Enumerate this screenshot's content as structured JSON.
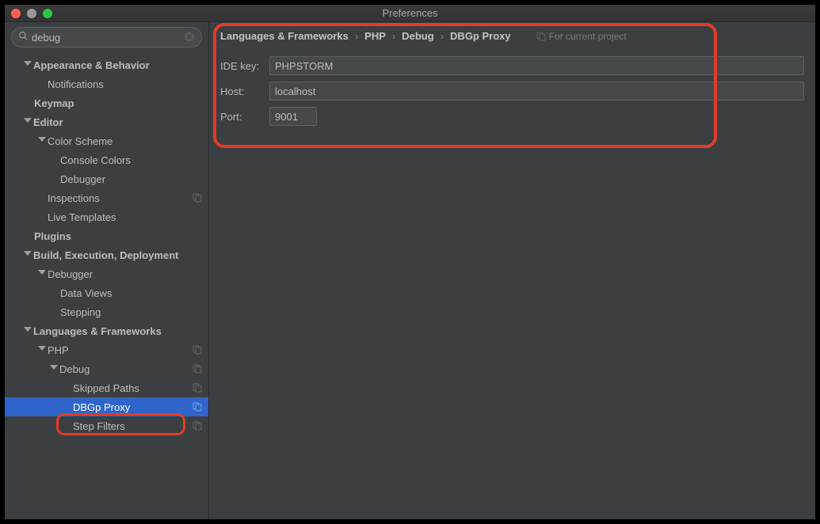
{
  "window": {
    "title": "Preferences"
  },
  "search": {
    "value": "debug"
  },
  "tree": {
    "n0": "Appearance & Behavior",
    "n1": "Notifications",
    "n2": "Keymap",
    "n3": "Editor",
    "n4": "Color Scheme",
    "n5": "Console Colors",
    "n6": "Debugger",
    "n7": "Inspections",
    "n8": "Live Templates",
    "n9": "Plugins",
    "n10": "Build, Execution, Deployment",
    "n11": "Debugger",
    "n12": "Data Views",
    "n13": "Stepping",
    "n14": "Languages & Frameworks",
    "n15": "PHP",
    "n16": "Debug",
    "n17": "Skipped Paths",
    "n18": "DBGp Proxy",
    "n19": "Step Filters"
  },
  "breadcrumb": {
    "a": "Languages & Frameworks",
    "b": "PHP",
    "c": "Debug",
    "d": "DBGp Proxy",
    "note": "For current project"
  },
  "form": {
    "ide_key_label": "IDE key:",
    "ide_key_value": "PHPSTORM",
    "host_label": "Host:",
    "host_value": "localhost",
    "port_label": "Port:",
    "port_value": "9001"
  }
}
